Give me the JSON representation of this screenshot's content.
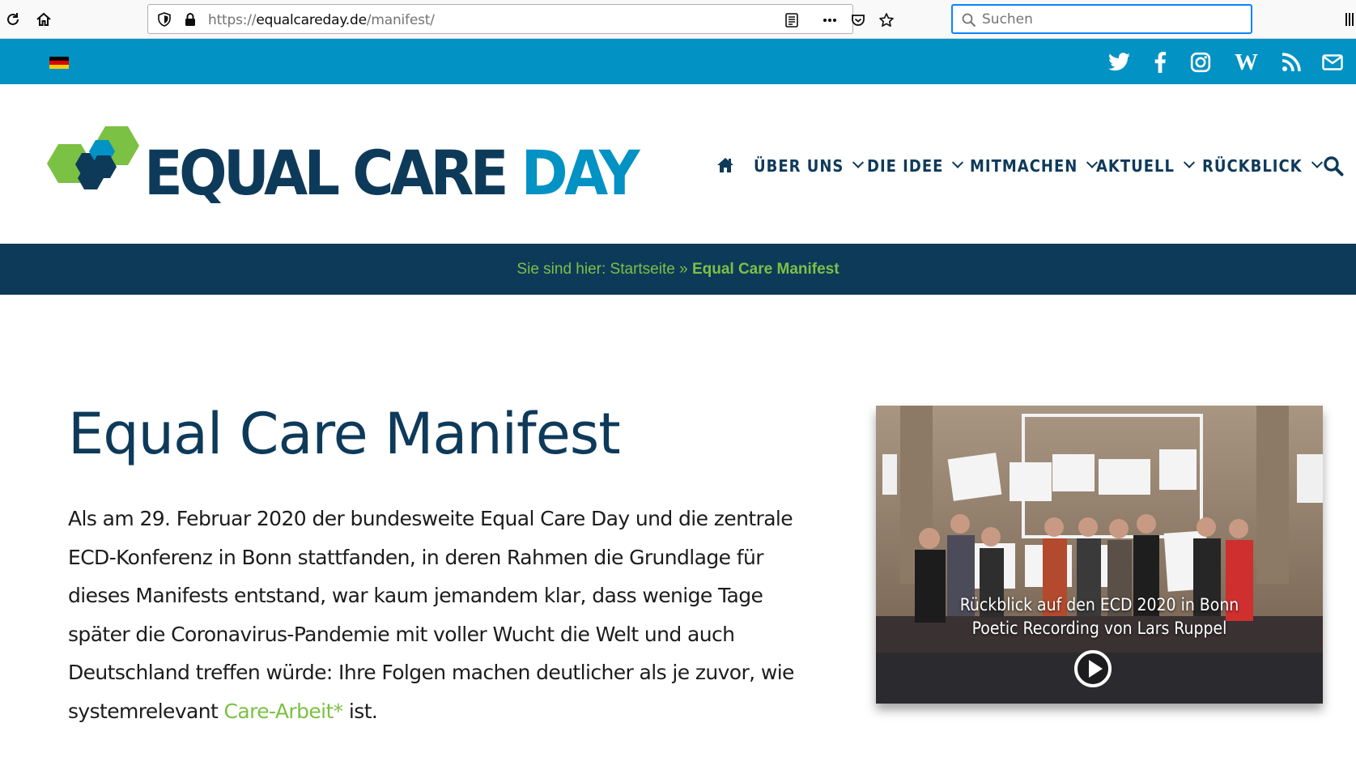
{
  "browser": {
    "url_prefix": "https://",
    "url_host": "equalcareday.de",
    "url_path": "/manifest/",
    "search_placeholder": "Suchen"
  },
  "social": {
    "language_flag": "german-flag",
    "icons": [
      "twitter-icon",
      "facebook-icon",
      "instagram-icon",
      "wikipedia-icon",
      "rss-icon",
      "mail-icon"
    ]
  },
  "logo": {
    "word1": "EQUAL",
    "word2": "CARE",
    "word3": "DAY"
  },
  "nav": {
    "items": [
      {
        "label": "ÜBER UNS"
      },
      {
        "label": "DIE IDEE"
      },
      {
        "label": "MITMACHEN"
      },
      {
        "label": "AKTUELL"
      },
      {
        "label": "RÜCKBLICK"
      }
    ]
  },
  "breadcrumb": {
    "prefix": "Sie sind hier:",
    "home": "Startseite",
    "separator": "»",
    "current": "Equal Care Manifest"
  },
  "main": {
    "title": "Equal Care Manifest",
    "intro_text": "Als am 29. Februar 2020 der bundesweite Equal Care Day und die zentrale ECD-Konferenz in Bonn stattfanden, in deren Rahmen die Grundlage für dieses Manifests entstand, war kaum jemandem klar, dass wenige Tage später die Coronavirus-Pandemie mit voller Wucht die Welt und auch Deutschland treffen würde: Ihre Folgen machen deutlicher als je zuvor, wie systemrelevant ",
    "intro_link": "Care-Arbeit*",
    "intro_tail": " ist."
  },
  "video": {
    "caption_line1": "Rückblick auf den ECD 2020 in Bonn",
    "caption_line2": "Poetic Recording von Lars Ruppel"
  },
  "colors": {
    "brand_dark": "#0e3a5a",
    "brand_blue": "#0292c4",
    "brand_green": "#7bc143"
  }
}
